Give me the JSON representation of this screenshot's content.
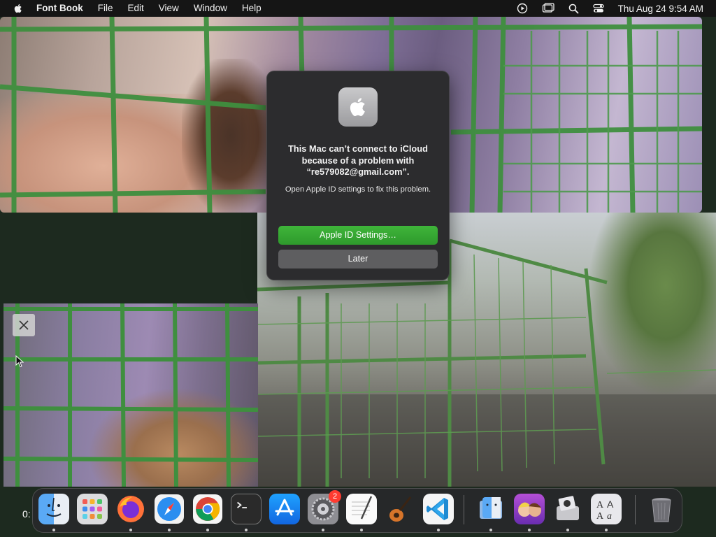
{
  "menubar": {
    "app_name": "Font Book",
    "menus": [
      "File",
      "Edit",
      "View",
      "Window",
      "Help"
    ],
    "clock": "Thu Aug 24  9:54 AM",
    "status_icons": [
      "play-circle-icon",
      "window-icon",
      "search-icon",
      "control-center-icon"
    ]
  },
  "dialog": {
    "icon": "apple-logo-icon",
    "title": "This Mac can’t connect to iCloud because of a problem with “re579082@gmail.com”.",
    "body": "Open Apple ID settings to fix this problem.",
    "primary_button": "Apple ID Settings…",
    "secondary_button": "Later"
  },
  "video": {
    "close_icon": "close-icon"
  },
  "dock": {
    "left_edge_text": "0:",
    "apps": [
      {
        "name": "Finder",
        "icon": "finder-icon"
      },
      {
        "name": "Launchpad",
        "icon": "launchpad-icon"
      },
      {
        "name": "Firefox",
        "icon": "firefox-icon"
      },
      {
        "name": "Safari",
        "icon": "safari-icon"
      },
      {
        "name": "Chrome",
        "icon": "chrome-icon"
      },
      {
        "name": "Terminal",
        "icon": "terminal-icon"
      },
      {
        "name": "App Store",
        "icon": "app-store-icon"
      },
      {
        "name": "System Settings",
        "icon": "system-settings-icon",
        "badge": "2"
      },
      {
        "name": "TextEdit",
        "icon": "textedit-icon"
      },
      {
        "name": "GarageBand",
        "icon": "garageband-icon"
      },
      {
        "name": "VS Code",
        "icon": "vscode-icon"
      },
      {
        "name": "Finder (folder)",
        "icon": "folder-finder-icon"
      },
      {
        "name": "Game",
        "icon": "game-icon"
      },
      {
        "name": "Disk Utility",
        "icon": "disk-utility-icon"
      },
      {
        "name": "Font Book",
        "icon": "font-book-icon"
      },
      {
        "name": "Trash",
        "icon": "trash-icon"
      }
    ]
  },
  "colors": {
    "dialog_bg": "#2c2c2e",
    "primary_button": "#34a832",
    "secondary_button": "#5e5e60",
    "badge": "#ff3b30"
  }
}
